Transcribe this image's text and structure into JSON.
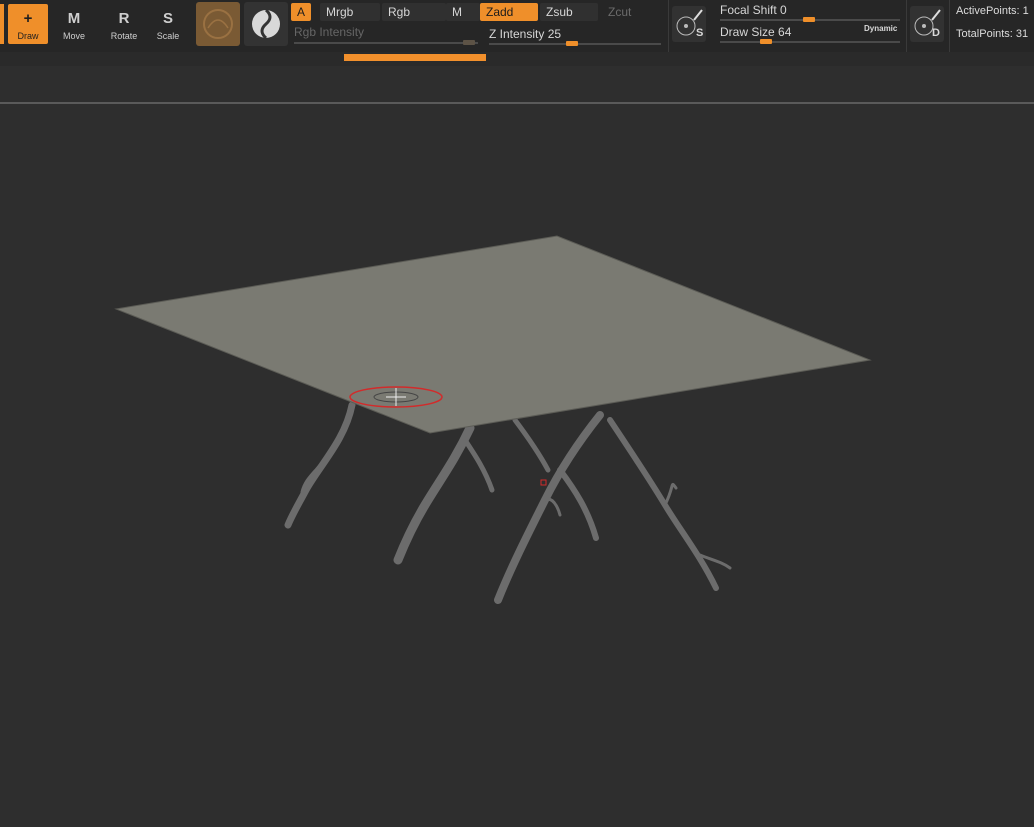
{
  "toolbar": {
    "tools": [
      {
        "label": "Draw",
        "glyph": "+",
        "active": true
      },
      {
        "label": "Move",
        "glyph": "M",
        "active": false
      },
      {
        "label": "Rotate",
        "glyph": "R",
        "active": false
      },
      {
        "label": "Scale",
        "glyph": "S",
        "active": false
      }
    ],
    "channels": {
      "a": "A",
      "mrgb": "Mrgb",
      "rgb": "Rgb",
      "m": "M",
      "zadd": "Zadd",
      "zsub": "Zsub",
      "zcut": "Zcut"
    },
    "rgb_intensity": {
      "label": "Rgb Intensity"
    },
    "z_intensity": {
      "label": "Z Intensity",
      "value": "25"
    },
    "focal_shift": {
      "label": "Focal Shift",
      "value": "0"
    },
    "draw_size": {
      "label": "Draw Size",
      "value": "64"
    },
    "dynamic_label": "Dynamic",
    "s_badge": "S",
    "d_badge": "D",
    "active_points": "ActivePoints: 1",
    "total_points": "TotalPoints: 31"
  },
  "colors": {
    "accent": "#ef8f2a",
    "background": "#2e2e2e",
    "plane": "#7a7a72",
    "roots": "#6b6b6b",
    "cursor_ring": "#d22b2b"
  },
  "icons": [
    "draw-icon",
    "move-icon",
    "rotate-icon",
    "scale-icon",
    "material-sphere-icon",
    "standard-brush-icon",
    "stroke-settings-icon",
    "draw-settings-icon"
  ]
}
